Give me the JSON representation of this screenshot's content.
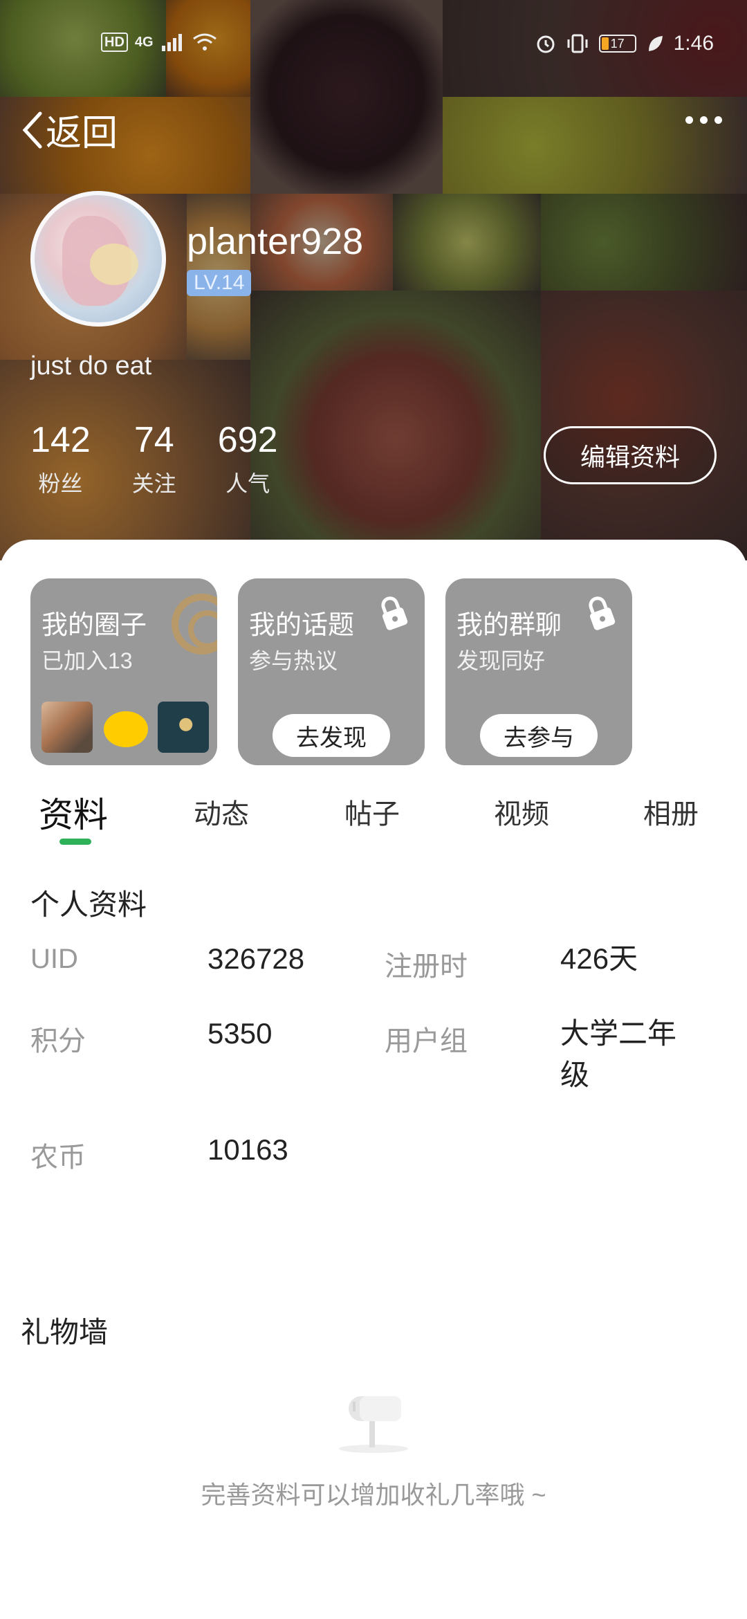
{
  "status_bar": {
    "network_chip": "HD",
    "signal_label": "4G",
    "battery_level": "17",
    "time": "1:46"
  },
  "header": {
    "back_label": "返回",
    "username": "planter928",
    "level": "LV.14",
    "bio": "just do eat",
    "stats": [
      {
        "num": "142",
        "label": "粉丝"
      },
      {
        "num": "74",
        "label": "关注"
      },
      {
        "num": "692",
        "label": "人气"
      }
    ],
    "edit_label": "编辑资料"
  },
  "cards": [
    {
      "title": "我的圈子",
      "sub": "已加入13",
      "button": ""
    },
    {
      "title": "我的话题",
      "sub": "参与热议",
      "button": "去发现"
    },
    {
      "title": "我的群聊",
      "sub": "发现同好",
      "button": "去参与"
    }
  ],
  "tabs": [
    "资料",
    "动态",
    "帖子",
    "视频",
    "相册"
  ],
  "profile": {
    "section_title": "个人资料",
    "fields": [
      {
        "label": "UID",
        "value": "326728"
      },
      {
        "label": "注册时",
        "value": "426天"
      },
      {
        "label": "积分",
        "value": "5350"
      },
      {
        "label": "用户组",
        "value": "大学二年级"
      },
      {
        "label": "农币",
        "value": "10163"
      }
    ]
  },
  "gifts": {
    "section_title": "礼物墙",
    "empty_text": "完善资料可以增加收礼几率哦 ~"
  }
}
